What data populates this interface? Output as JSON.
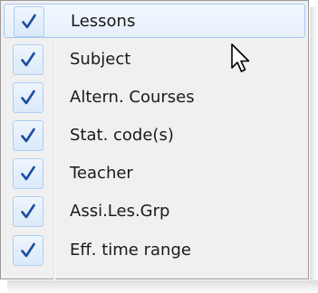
{
  "menu": {
    "items": [
      {
        "label": "Lessons",
        "checked": true,
        "hovered": true
      },
      {
        "label": "Subject",
        "checked": true
      },
      {
        "label": "Altern. Courses",
        "checked": true
      },
      {
        "label": "Stat. code(s)",
        "checked": true
      },
      {
        "label": "Teacher",
        "checked": true
      },
      {
        "label": "Assi.Les.Grp",
        "checked": true
      },
      {
        "label": "Eff. time range",
        "checked": true
      }
    ],
    "check_icon": "checkmark-icon",
    "cursor_icon": "mouse-pointer-icon"
  },
  "colors": {
    "menu_background": "#f0f0f0",
    "menu_border": "#9a9a9a",
    "hover_border": "#a8c8ec",
    "check_box_border": "#aecff2",
    "checkmark": "#1b4ea1",
    "text": "#1a1a1a"
  }
}
